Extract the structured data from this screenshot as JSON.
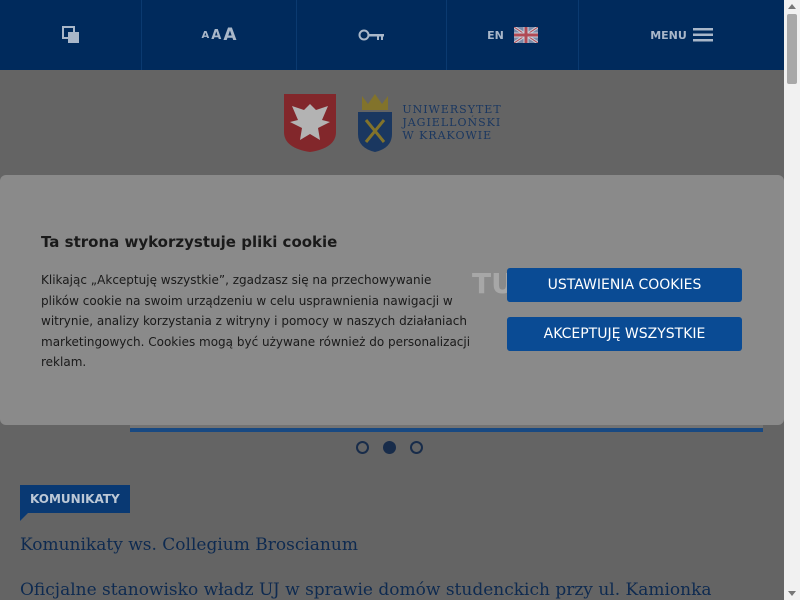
{
  "topbar": {
    "font_size_small": "A",
    "font_size_medium": "A",
    "font_size_large": "A",
    "lang_code": "EN",
    "menu_label": "MENU"
  },
  "logo": {
    "line1": "UNIWERSYTET",
    "line2": "JAGIELLOŃSKI",
    "line3": "W KRAKOWIE"
  },
  "cookie": {
    "title": "Ta strona wykorzystuje pliki cookie",
    "text": "Klikając „Akceptuję wszystkie”, zgadzasz się na przechowywanie plików cookie na swoim urządzeniu w celu usprawnienia nawigacji w witrynie, analizy korzystania z witryny i pomocy w naszych działaniach marketingowych. Cookies mogą być używane również do personalizacji reklam.",
    "settings_label": "USTAWIENIA COOKIES",
    "accept_label": "AKCEPTUJĘ WSZYSTKIE"
  },
  "section": {
    "label": "KOMUNIKATY"
  },
  "news": [
    "Komunikaty ws. Collegium Broscianum",
    "Oficjalne stanowisko władz UJ w sprawie domów studenckich przy ul. Kamionka"
  ],
  "colors": {
    "topbar": "#002a5c",
    "button": "#0a4b94",
    "label": "#0a3d7a"
  }
}
